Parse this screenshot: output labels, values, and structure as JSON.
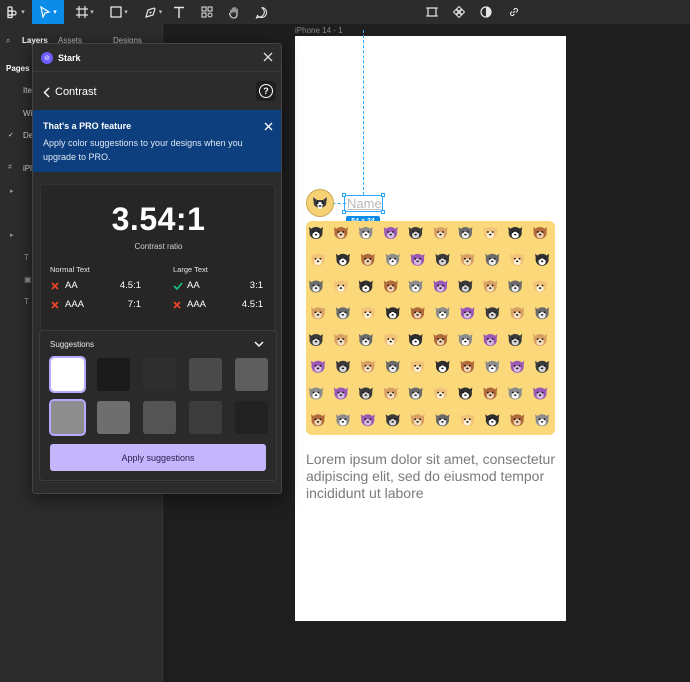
{
  "toolbar": {
    "tools": [
      {
        "name": "main-menu-icon"
      },
      {
        "name": "move-tool-icon",
        "active": true
      },
      {
        "name": "frame-tool-icon"
      },
      {
        "name": "shape-tool-icon"
      },
      {
        "name": "pen-tool-icon"
      },
      {
        "name": "text-tool-icon"
      },
      {
        "name": "component-tool-icon"
      },
      {
        "name": "hand-tool-icon"
      },
      {
        "name": "comment-tool-icon"
      }
    ],
    "right_tools": [
      {
        "name": "crop-icon"
      },
      {
        "name": "component-icon"
      },
      {
        "name": "contrast-icon"
      },
      {
        "name": "link-icon"
      }
    ],
    "accent": "#0c8ce9"
  },
  "left_panel": {
    "tabs": {
      "layers": "Layers",
      "assets": "Assets",
      "designs": "Designs"
    },
    "pages_label": "Pages",
    "partial_items": [
      "Ite",
      "Wi",
      "De"
    ],
    "layer_partial": "iPl"
  },
  "canvas": {
    "frame_label": "iPhone 14 - 1",
    "name_text": "Name",
    "dimension_badge": "54 × 24",
    "lorem": "Lorem ipsum dolor sit amet, consectetur adipiscing elit, sed do eiusmod tempor incididunt ut labore",
    "grid_color": "#fbd97b"
  },
  "plugin": {
    "app_name": "Stark",
    "screen_title": "Contrast",
    "pro_banner": {
      "title": "That's a PRO feature",
      "body": "Apply color suggestions to your designs when you upgrade to PRO."
    },
    "ratio": "3.54:1",
    "ratio_caption": "Contrast ratio",
    "normal_text": {
      "heading": "Normal Text",
      "rows": [
        {
          "level": "AA",
          "pass": false,
          "required": "4.5:1"
        },
        {
          "level": "AAA",
          "pass": false,
          "required": "7:1"
        }
      ]
    },
    "large_text": {
      "heading": "Large Text",
      "rows": [
        {
          "level": "AA",
          "pass": true,
          "required": "3:1"
        },
        {
          "level": "AAA",
          "pass": false,
          "required": "4.5:1"
        }
      ]
    },
    "suggestions": {
      "title": "Suggestions",
      "swatches_row1": [
        "#ffffff",
        "#1a1a1a",
        "#2e2e2e",
        "#4a4a4a",
        "#5e5e5e"
      ],
      "swatches_row2": [
        "#8e8e8e",
        "#6e6e6e",
        "#545454",
        "#3c3c3c",
        "#222222"
      ],
      "apply_label": "Apply suggestions"
    },
    "colors": {
      "fail": "#f24822",
      "pass": "#1bc47d",
      "banner": "#0d3f7e",
      "button": "#c4b5fd"
    }
  }
}
